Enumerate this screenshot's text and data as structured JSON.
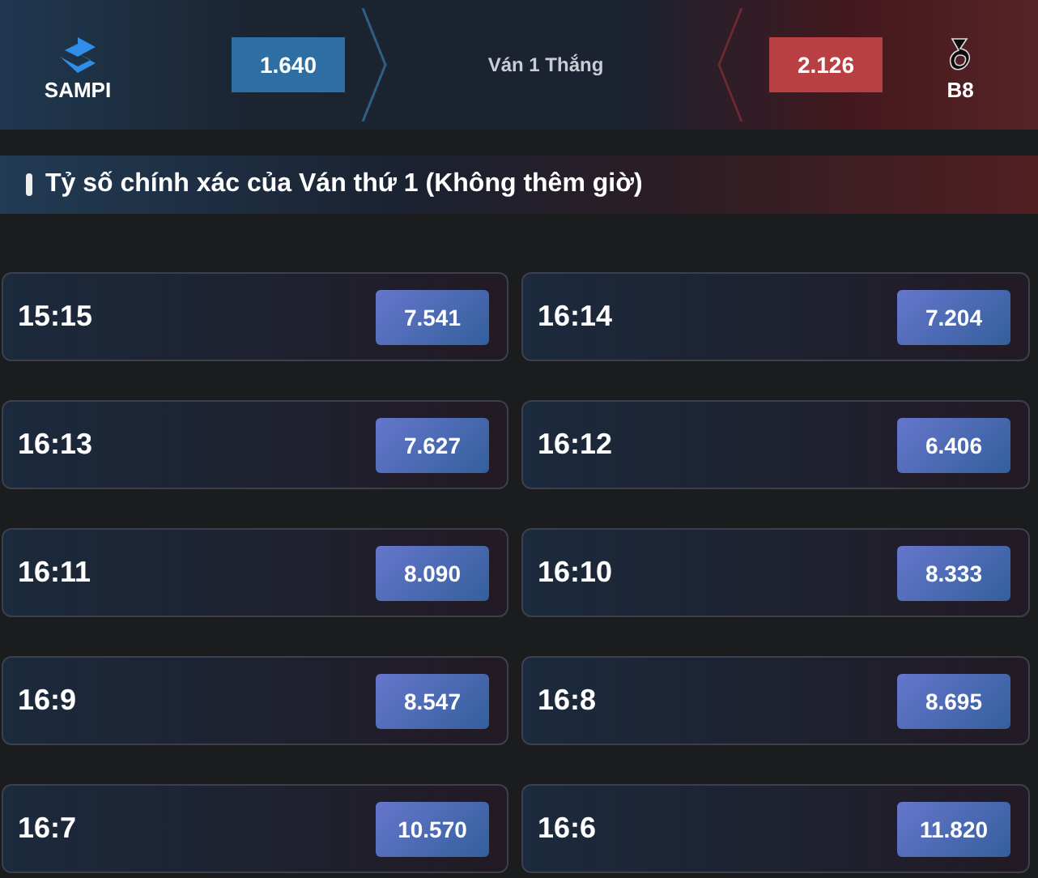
{
  "match": {
    "home": {
      "name": "SAMPI",
      "odds": "1.640"
    },
    "market": "Ván 1 Thắng",
    "away": {
      "name": "B8",
      "odds": "2.126"
    }
  },
  "section": {
    "title": "Tỷ số chính xác của Ván thứ 1 (Không thêm giờ)"
  },
  "scores": [
    {
      "score": "15:15",
      "odds": "7.541"
    },
    {
      "score": "16:14",
      "odds": "7.204"
    },
    {
      "score": "16:13",
      "odds": "7.627"
    },
    {
      "score": "16:12",
      "odds": "6.406"
    },
    {
      "score": "16:11",
      "odds": "8.090"
    },
    {
      "score": "16:10",
      "odds": "8.333"
    },
    {
      "score": "16:9",
      "odds": "8.547"
    },
    {
      "score": "16:8",
      "odds": "8.695"
    },
    {
      "score": "16:7",
      "odds": "10.570"
    },
    {
      "score": "16:6",
      "odds": "11.820"
    }
  ]
}
